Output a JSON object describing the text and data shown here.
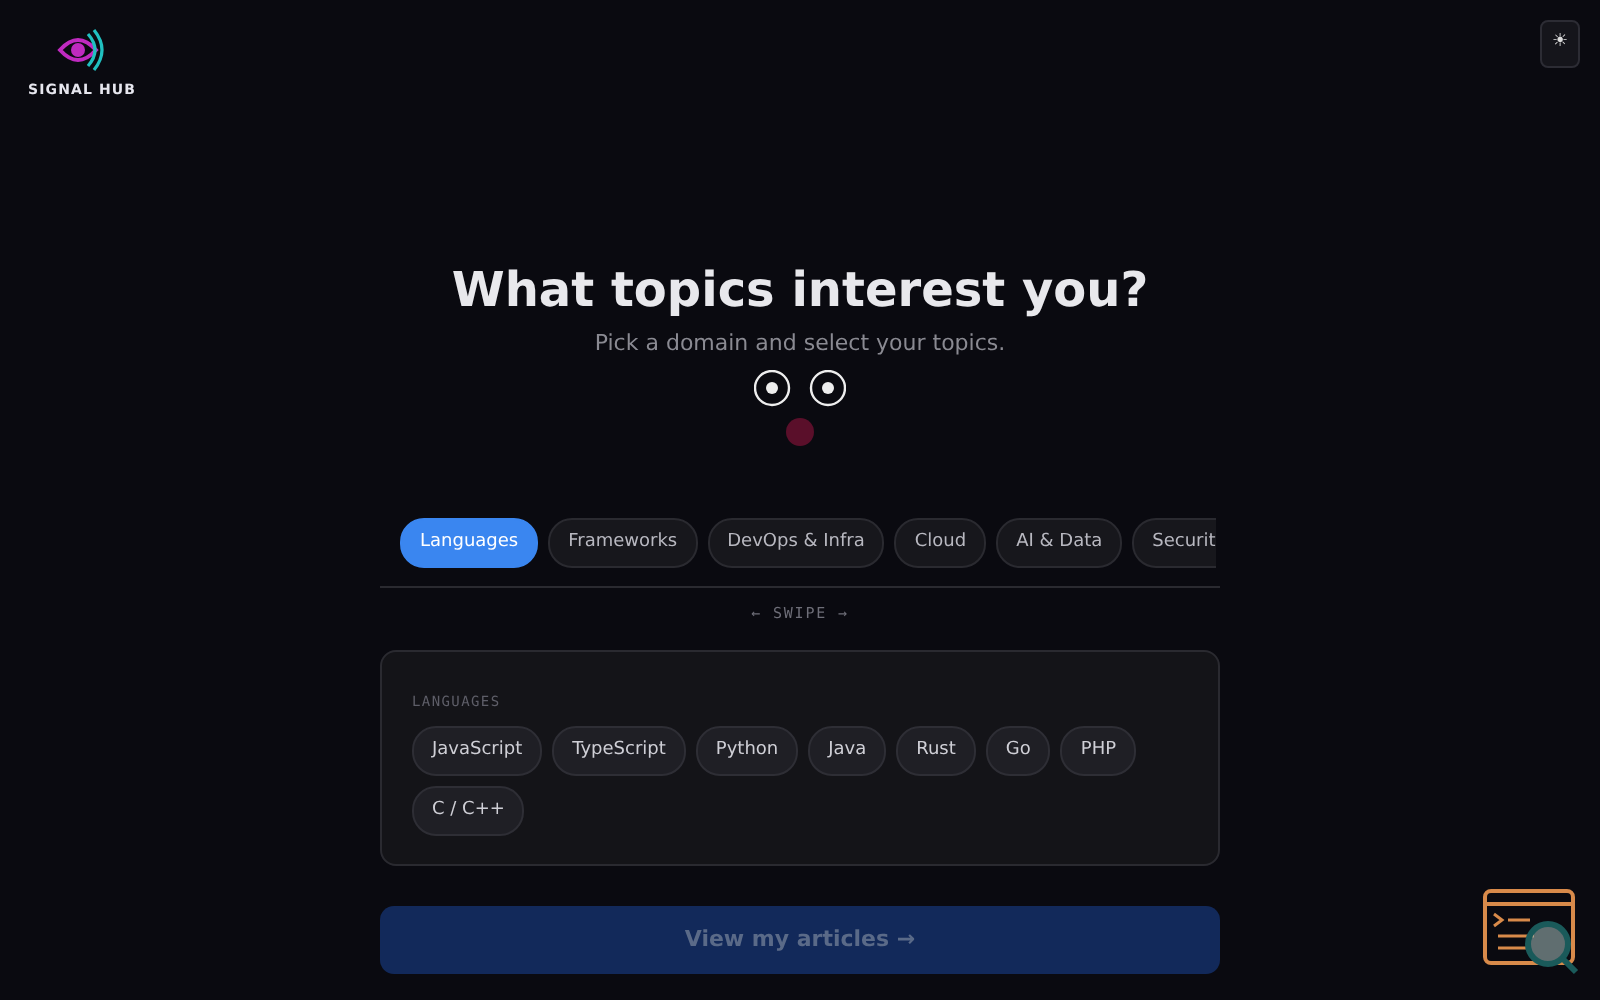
{
  "brand": {
    "name": "SIGNAL HUB"
  },
  "heading": "What topics interest you?",
  "subheading": "Pick a domain and select your topics.",
  "theme_toggle": {
    "label": "☀"
  },
  "tabs": [
    {
      "label": "Languages",
      "selected": true
    },
    {
      "label": "Frameworks",
      "selected": false
    },
    {
      "label": "DevOps & Infra",
      "selected": false
    },
    {
      "label": "Cloud",
      "selected": false
    },
    {
      "label": "AI & Data",
      "selected": false
    },
    {
      "label": "Securit",
      "selected": false
    }
  ],
  "swipe_hint": "← SWIPE →",
  "panel": {
    "title": "LANGUAGES",
    "topics": [
      {
        "label": "JavaScript",
        "selected": false
      },
      {
        "label": "TypeScript",
        "selected": false
      },
      {
        "label": "Python",
        "selected": false
      },
      {
        "label": "Java",
        "selected": false
      },
      {
        "label": "Rust",
        "selected": false
      },
      {
        "label": "Go",
        "selected": false
      },
      {
        "label": "PHP",
        "selected": false
      },
      {
        "label": "C / C++",
        "selected": false
      }
    ]
  },
  "submit": {
    "label": "View my articles →",
    "disabled": true
  }
}
